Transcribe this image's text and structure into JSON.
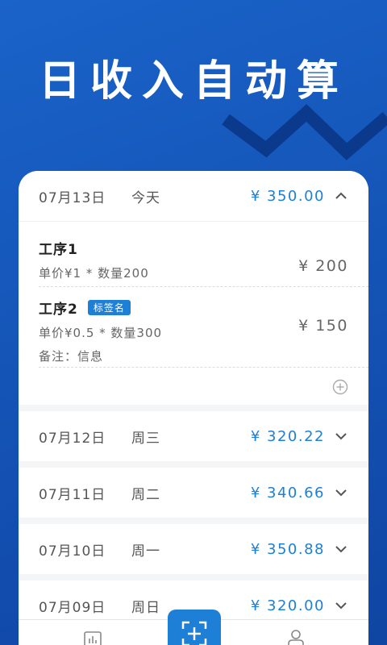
{
  "headline": "日收入自动算",
  "colors": {
    "accent": "#1d7fd6",
    "background": "#1555b8",
    "zigzag": "#0b3a8c"
  },
  "expanded_day": {
    "date": "07月13日",
    "weekday": "今天",
    "amount": "¥ 350.00",
    "items": [
      {
        "title": "工序1",
        "detail": "单价¥1 * 数量200",
        "total": "¥ 200"
      },
      {
        "title": "工序2",
        "tag": "标签名",
        "detail": "单价¥0.5 * 数量300",
        "note": "备注：信息",
        "total": "¥ 150"
      }
    ]
  },
  "days": [
    {
      "date": "07月12日",
      "weekday": "周三",
      "amount": "¥ 320.22"
    },
    {
      "date": "07月11日",
      "weekday": "周二",
      "amount": "¥ 340.66"
    },
    {
      "date": "07月10日",
      "weekday": "周一",
      "amount": "¥ 350.88"
    },
    {
      "date": "07月09日",
      "weekday": "周日",
      "amount": "¥ 320.00"
    }
  ],
  "nav": {
    "stats_icon": "bar-chart-icon",
    "scan_icon": "scan-add-icon",
    "user_icon": "user-icon"
  }
}
